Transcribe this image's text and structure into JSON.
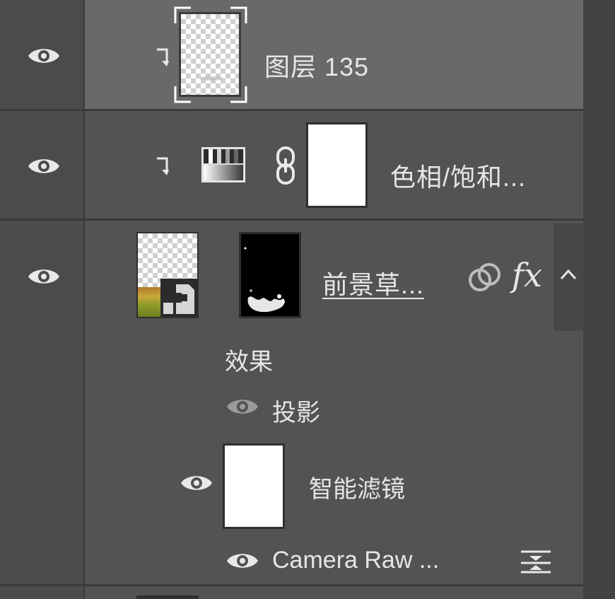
{
  "layers": {
    "layer1": {
      "name": "图层 135",
      "visible": true,
      "selected": true,
      "clipped": true
    },
    "layer2": {
      "name": "色相/饱和...",
      "visible": true,
      "clipped": true,
      "type": "adjustment-hue-saturation"
    },
    "layer3": {
      "name": "前景草...",
      "visible": true,
      "smart_object": true,
      "expanded": true,
      "effects_header": "效果",
      "effects": [
        {
          "name": "投影",
          "visible": true
        }
      ],
      "smart_filters_label": "智能滤镜",
      "smart_filters": [
        {
          "name": "Camera Raw ...",
          "visible": true
        }
      ]
    }
  },
  "icons": {
    "eye": "eye-icon",
    "clip": "clipping-arrow-icon",
    "link": "chain-link-icon",
    "blend": "blending-options-icon",
    "fx": "fx-icon",
    "collapse": "chevron-up-icon",
    "filter_options": "filter-blending-options-icon"
  },
  "fx_text": "fx",
  "colors": {
    "panel_bg": "#535353",
    "selected_row": "#696969",
    "separator": "#3a3a3a",
    "text": "#e6e6e6"
  }
}
